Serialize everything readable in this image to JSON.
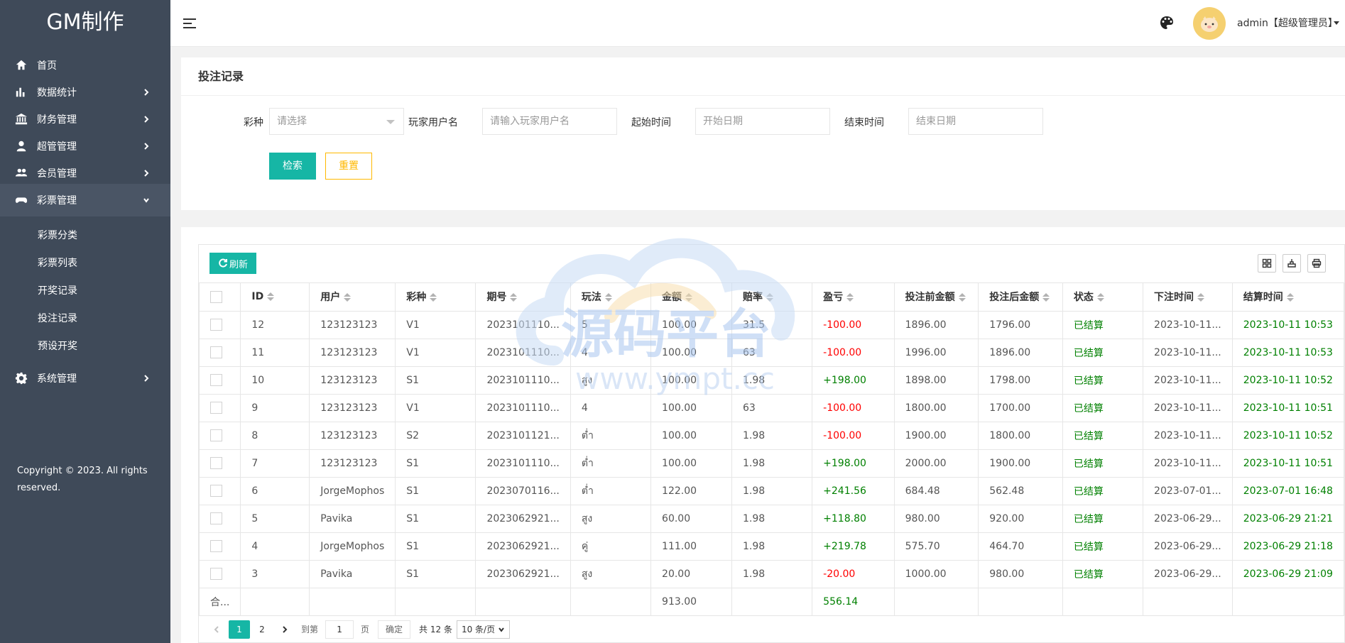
{
  "app": {
    "logo": "GM制作"
  },
  "sidebar": {
    "items": [
      {
        "label": "首页",
        "icon": "home-icon",
        "arrow": false
      },
      {
        "label": "数据统计",
        "icon": "bar-chart-icon",
        "arrow": true
      },
      {
        "label": "财务管理",
        "icon": "bank-icon",
        "arrow": true
      },
      {
        "label": "超管管理",
        "icon": "user-icon",
        "arrow": true
      },
      {
        "label": "会员管理",
        "icon": "users-icon",
        "arrow": true
      },
      {
        "label": "彩票管理",
        "icon": "gamepad-icon",
        "arrow": true,
        "expanded": true
      }
    ],
    "sub_items": [
      "彩票分类",
      "彩票列表",
      "开奖记录",
      "投注记录",
      "预设开奖"
    ],
    "system": {
      "label": "系统管理",
      "icon": "gear-icon"
    },
    "copyright_line1": "Copyright © 2023. All rights",
    "copyright_line2": "reserved."
  },
  "header": {
    "user": "admin【超级管理员】"
  },
  "search": {
    "title": "投注记录",
    "lottery_label": "彩种",
    "lottery_placeholder": "请选择",
    "player_label": "玩家用户名",
    "player_placeholder": "请输入玩家用户名",
    "start_label": "起始时间",
    "start_placeholder": "开始日期",
    "end_label": "结束时间",
    "end_placeholder": "结束日期",
    "search_btn": "检索",
    "reset_btn": "重置"
  },
  "table": {
    "refresh_btn": "刷新",
    "columns": [
      "ID",
      "用户",
      "彩种",
      "期号",
      "玩法",
      "金额",
      "赔率",
      "盈亏",
      "投注前金额",
      "投注后金额",
      "状态",
      "下注时间",
      "结算时间"
    ],
    "rows": [
      {
        "id": "12",
        "user": "123123123",
        "lottery": "V1",
        "period": "2023101110...",
        "play": "5",
        "amount": "100.00",
        "odds": "31.5",
        "pnl": "-100.00",
        "before": "1896.00",
        "after": "1796.00",
        "status": "已结算",
        "bet_time": "2023-10-11...",
        "settle_time": "2023-10-11 10:53"
      },
      {
        "id": "11",
        "user": "123123123",
        "lottery": "V1",
        "period": "2023101110...",
        "play": "4",
        "amount": "100.00",
        "odds": "63",
        "pnl": "-100.00",
        "before": "1996.00",
        "after": "1896.00",
        "status": "已结算",
        "bet_time": "2023-10-11...",
        "settle_time": "2023-10-11 10:53"
      },
      {
        "id": "10",
        "user": "123123123",
        "lottery": "S1",
        "period": "2023101110...",
        "play": "สูง",
        "amount": "100.00",
        "odds": "1.98",
        "pnl": "+198.00",
        "before": "1898.00",
        "after": "1798.00",
        "status": "已结算",
        "bet_time": "2023-10-11...",
        "settle_time": "2023-10-11 10:52"
      },
      {
        "id": "9",
        "user": "123123123",
        "lottery": "V1",
        "period": "2023101110...",
        "play": "4",
        "amount": "100.00",
        "odds": "63",
        "pnl": "-100.00",
        "before": "1800.00",
        "after": "1700.00",
        "status": "已结算",
        "bet_time": "2023-10-11...",
        "settle_time": "2023-10-11 10:51"
      },
      {
        "id": "8",
        "user": "123123123",
        "lottery": "S2",
        "period": "2023101121...",
        "play": "ต่ำ",
        "amount": "100.00",
        "odds": "1.98",
        "pnl": "-100.00",
        "before": "1900.00",
        "after": "1800.00",
        "status": "已结算",
        "bet_time": "2023-10-11...",
        "settle_time": "2023-10-11 10:52"
      },
      {
        "id": "7",
        "user": "123123123",
        "lottery": "S1",
        "period": "2023101110...",
        "play": "ต่ำ",
        "amount": "100.00",
        "odds": "1.98",
        "pnl": "+198.00",
        "before": "2000.00",
        "after": "1900.00",
        "status": "已结算",
        "bet_time": "2023-10-11...",
        "settle_time": "2023-10-11 10:51"
      },
      {
        "id": "6",
        "user": "JorgeMophos",
        "lottery": "S1",
        "period": "2023070116...",
        "play": "ต่ำ",
        "amount": "122.00",
        "odds": "1.98",
        "pnl": "+241.56",
        "before": "684.48",
        "after": "562.48",
        "status": "已结算",
        "bet_time": "2023-07-01...",
        "settle_time": "2023-07-01 16:48"
      },
      {
        "id": "5",
        "user": "Pavika",
        "lottery": "S1",
        "period": "2023062921...",
        "play": "สูง",
        "amount": "60.00",
        "odds": "1.98",
        "pnl": "+118.80",
        "before": "980.00",
        "after": "920.00",
        "status": "已结算",
        "bet_time": "2023-06-29...",
        "settle_time": "2023-06-29 21:21"
      },
      {
        "id": "4",
        "user": "JorgeMophos",
        "lottery": "S1",
        "period": "2023062921...",
        "play": "คู่",
        "amount": "111.00",
        "odds": "1.98",
        "pnl": "+219.78",
        "before": "575.70",
        "after": "464.70",
        "status": "已结算",
        "bet_time": "2023-06-29...",
        "settle_time": "2023-06-29 21:18"
      },
      {
        "id": "3",
        "user": "Pavika",
        "lottery": "S1",
        "period": "2023062921...",
        "play": "สูง",
        "amount": "20.00",
        "odds": "1.98",
        "pnl": "-20.00",
        "before": "1000.00",
        "after": "980.00",
        "status": "已结算",
        "bet_time": "2023-06-29...",
        "settle_time": "2023-06-29 21:09"
      }
    ],
    "total_label": "合...",
    "total_amount": "913.00",
    "total_pnl": "556.14"
  },
  "pagination": {
    "pages": [
      "1",
      "2"
    ],
    "current": "1",
    "goto_label": "到第",
    "goto_value": "1",
    "page_unit": "页",
    "confirm": "确定",
    "total": "共 12 条",
    "page_size": "10 条/页"
  },
  "watermark": {
    "line1": "源码平台",
    "line2": "www.ympt.cc"
  },
  "colors": {
    "sidebar": "#3f4a59",
    "accent": "#16b6a5",
    "warning": "#ffb800",
    "loss": "#ff0000",
    "gain": "#008000"
  }
}
